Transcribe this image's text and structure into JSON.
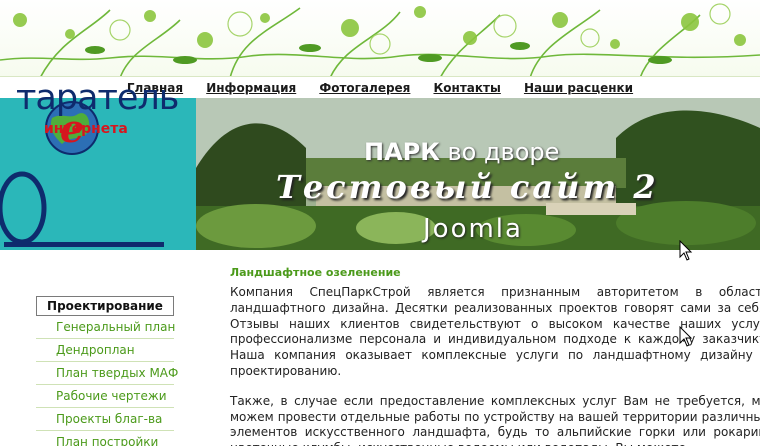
{
  "nav": {
    "items": [
      "Главная",
      "Информация",
      "Фотогалерея",
      "Контакты",
      "Наши расценки"
    ]
  },
  "banner": {
    "logo_word": "тарател",
    "logo_word_end": "ь",
    "logo_sub": "интернета",
    "park_title_bold": "ПАРК",
    "park_title_rest": " во дворе",
    "site_title": "Тестовый сайт 2",
    "cms": "Joomla"
  },
  "sidebar": {
    "heading": "Проектирование",
    "items": [
      "Генеральный план",
      "Дендроплан",
      "План твердых МАФ",
      "Рабочие чертежи",
      "Проекты благ-ва",
      "План постройки"
    ]
  },
  "content": {
    "heading": "Ландшафтное озеленение",
    "paragraph1": "Компания СпецПаркСтрой является признанным авторитетом в области ландшафтного дизайна. Десятки реализованных проектов говорят сами за себя. Отзывы наших клиентов свидетельствуют о высоком качестве наших услуг, профессионализме персонала и индивидуальном подходе к каждому заказчику. Наша компания оказывает комплексные услуги по ландшафтному дизайну и проектированию.",
    "paragraph2": "Также, в случае если предоставление комплексных услуг Вам не требуется, мы можем провести отдельные работы по устройству на вашей территории различных элементов искусственного ландшафта, будь то альпийские горки или рокарии, цветочные клумбы, искусственные водоемы или водопады. Вы можете"
  },
  "colors": {
    "accent_green": "#4b9a1a",
    "logo_teal": "#2bb7b9",
    "logo_red": "#d6161e",
    "logo_navy": "#0e2b6d"
  }
}
